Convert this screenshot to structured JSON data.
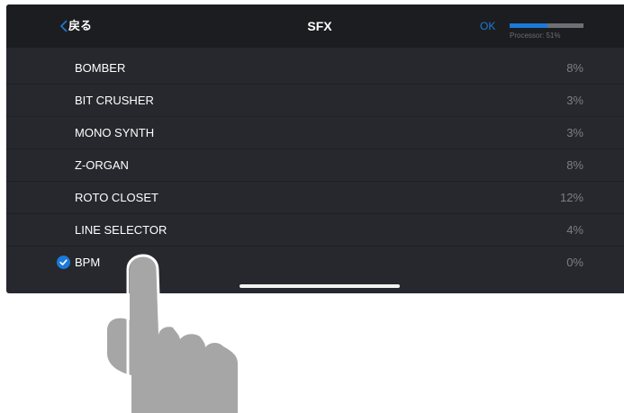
{
  "header": {
    "back_label": "戻る",
    "title": "SFX",
    "ok_label": "OK",
    "processor_label": "Processor: 51%",
    "processor_fraction": 0.51
  },
  "effects": [
    {
      "name": "BOMBER",
      "percent": "8%",
      "checked": false
    },
    {
      "name": "BIT CRUSHER",
      "percent": "3%",
      "checked": false
    },
    {
      "name": "MONO SYNTH",
      "percent": "3%",
      "checked": false
    },
    {
      "name": "Z-ORGAN",
      "percent": "8%",
      "checked": false
    },
    {
      "name": "ROTO CLOSET",
      "percent": "12%",
      "checked": false
    },
    {
      "name": "LINE SELECTOR",
      "percent": "4%",
      "checked": false
    },
    {
      "name": "BPM",
      "percent": "0%",
      "checked": true
    }
  ],
  "colors": {
    "accent": "#1b79da",
    "panel": "#26282d",
    "topbar": "#1c1d20",
    "hand": "#a6a6a6"
  },
  "icons": {
    "back": "chevron-left-icon",
    "check": "checkmark-circle-icon",
    "gesture": "tap-hand-icon"
  }
}
